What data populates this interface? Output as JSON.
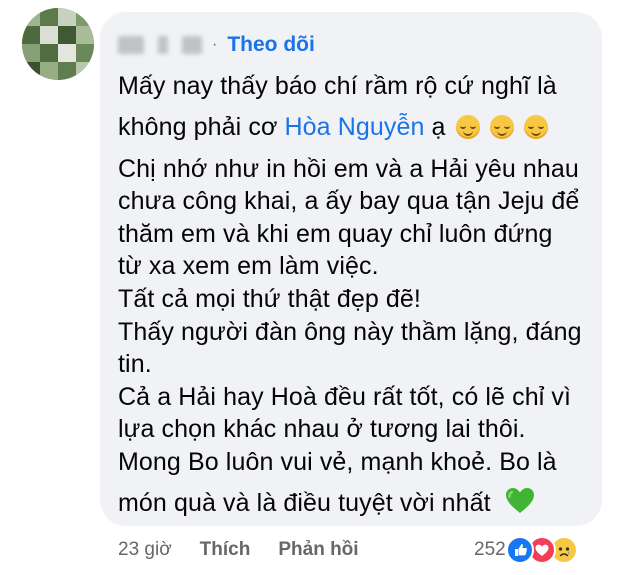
{
  "comment": {
    "author_label": "",
    "separator": "·",
    "follow_label": "Theo dõi",
    "lines": [
      {
        "text": "Mấy nay thấy báo chí rầm rộ cứ nghĩ là"
      },
      {
        "before": "không phải cơ ",
        "mention": "Hòa Nguyễn",
        "after": " ạ"
      },
      {
        "text": "Chị nhớ như in hồi em và a Hải yêu nhau"
      },
      {
        "text": "chưa công khai, a ấy bay qua tận Jeju để"
      },
      {
        "text": "thăm em và khi em quay chỉ luôn đứng"
      },
      {
        "text": "từ xa xem em làm việc."
      },
      {
        "text": "Tất cả mọi thứ thật đẹp đẽ!"
      },
      {
        "text": "Thấy người đàn ông này thầm lặng, đáng"
      },
      {
        "text": "tin."
      },
      {
        "text": "Cả a Hải hay Hoà đều rất tốt, có lẽ chỉ vì"
      },
      {
        "text": "lựa chọn khác nhau ở tương lai thôi."
      },
      {
        "text": "Mong Bo luôn vui vẻ, mạnh khoẻ. Bo là"
      },
      {
        "text": "món quà và là điều tuyệt vời nhất"
      }
    ],
    "emojis": [
      "relieved-face-icon",
      "relieved-face-icon",
      "relieved-face-icon",
      "green-heart-icon"
    ]
  },
  "actions": {
    "time": "23 giờ",
    "like_label": "Thích",
    "reply_label": "Phản hồi"
  },
  "reactions": {
    "count": "252",
    "icons": [
      "like-reaction-icon",
      "love-reaction-icon",
      "sad-reaction-icon"
    ]
  },
  "colors": {
    "bubble_bg": "#f0f2f5",
    "link_blue": "#1a73e8",
    "muted_text": "#65676b",
    "like_blue": "#1877f2",
    "love_red": "#f33e58"
  }
}
